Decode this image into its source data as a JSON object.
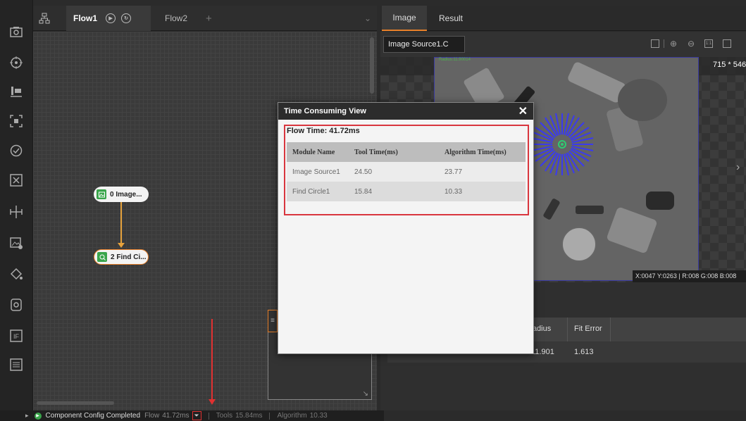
{
  "flow_tabs": {
    "tab1": "Flow1",
    "tab2": "Flow2",
    "add": "+",
    "dropdown": "⌄"
  },
  "nodes": {
    "image": "0 Image...",
    "find": "2 Find Ci..."
  },
  "status": {
    "text": "Component Config Completed",
    "flow": "Flow",
    "flow_time": "41.72ms",
    "tools": "Tools",
    "tools_time": "15.84ms",
    "algorithm": "Algorithm",
    "algorithm_time": "10.33"
  },
  "right_tabs": [
    "Image",
    "Result"
  ],
  "image_panel": {
    "source": "Image Source1.C",
    "size": "715 * 546",
    "coords": "X:0047 Y:0263 | R:008 G:008 B:008",
    "radius_tag": "Radius:11.90014"
  },
  "result_table": {
    "headers": [
      "Radius",
      "Fit Error"
    ],
    "row": [
      "11.901",
      "1.613"
    ]
  },
  "dialog": {
    "title": "Time Consuming View",
    "close": "✕",
    "flow_time": "Flow Time: 41.72ms",
    "headers": [
      "Module Name",
      "Tool Time(ms)",
      "Algorithm Time(ms)"
    ],
    "rows": [
      [
        "Image Source1",
        "24.50",
        "23.77"
      ],
      [
        "Find Circle1",
        "15.84",
        "10.33"
      ]
    ]
  },
  "colors": {
    "accent": "#e8802a",
    "highlight": "#d9363e",
    "node_icon": "#3aa54b"
  },
  "icons": [
    "camera-icon",
    "target-icon",
    "bars-icon",
    "focus-icon",
    "circle-check-icon",
    "grid-x-icon",
    "measure-icon",
    "image-edit-icon",
    "paint-icon",
    "shield-icon",
    "if-icon",
    "list-icon"
  ]
}
